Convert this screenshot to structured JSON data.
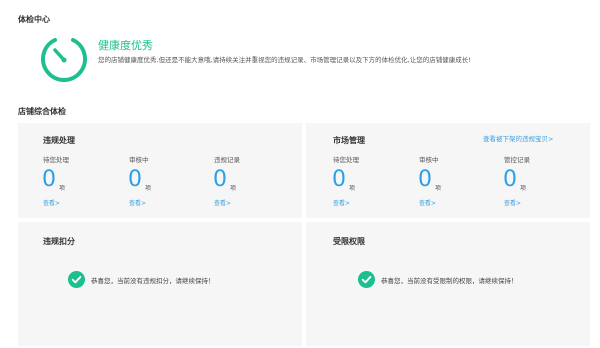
{
  "header": {
    "title": "体检中心"
  },
  "health": {
    "title": "健康度优秀",
    "description": "您的店铺健康度优秀,但还是不能大意哦,请持续关注并重视您的违规记录、市场管理记录以及下方的体检优化,让您的店铺健康成长!"
  },
  "section": {
    "title": "店铺综合体检"
  },
  "violation": {
    "title": "违规处理",
    "columns": [
      {
        "label": "待您处理",
        "value": "0",
        "unit": "项",
        "link": "查看>"
      },
      {
        "label": "审核中",
        "value": "0",
        "unit": "项",
        "link": "查看>"
      },
      {
        "label": "违规记录",
        "value": "0",
        "unit": "项",
        "link": "查看>"
      }
    ]
  },
  "market": {
    "title": "市场管理",
    "link": "查看被下架的违规宝贝>",
    "columns": [
      {
        "label": "待您处理",
        "value": "0",
        "unit": "项",
        "link": "查看>"
      },
      {
        "label": "审核中",
        "value": "0",
        "unit": "项",
        "link": "查看>"
      },
      {
        "label": "管控记录",
        "value": "0",
        "unit": "项",
        "link": "查看>"
      }
    ]
  },
  "deduction": {
    "title": "违规扣分",
    "message": "恭喜您，当前没有违规扣分，请继续保持！"
  },
  "restriction": {
    "title": "受限权限",
    "message": "恭喜您，当前没有受限制的权限，请继续保持！"
  },
  "colors": {
    "accent": "#1dbf8f",
    "link": "#3aa0e0",
    "number": "#2d9fe6",
    "panel": "#f6f6f6"
  },
  "icons": {
    "gauge": "gauge-icon",
    "check": "check-circle-icon"
  }
}
